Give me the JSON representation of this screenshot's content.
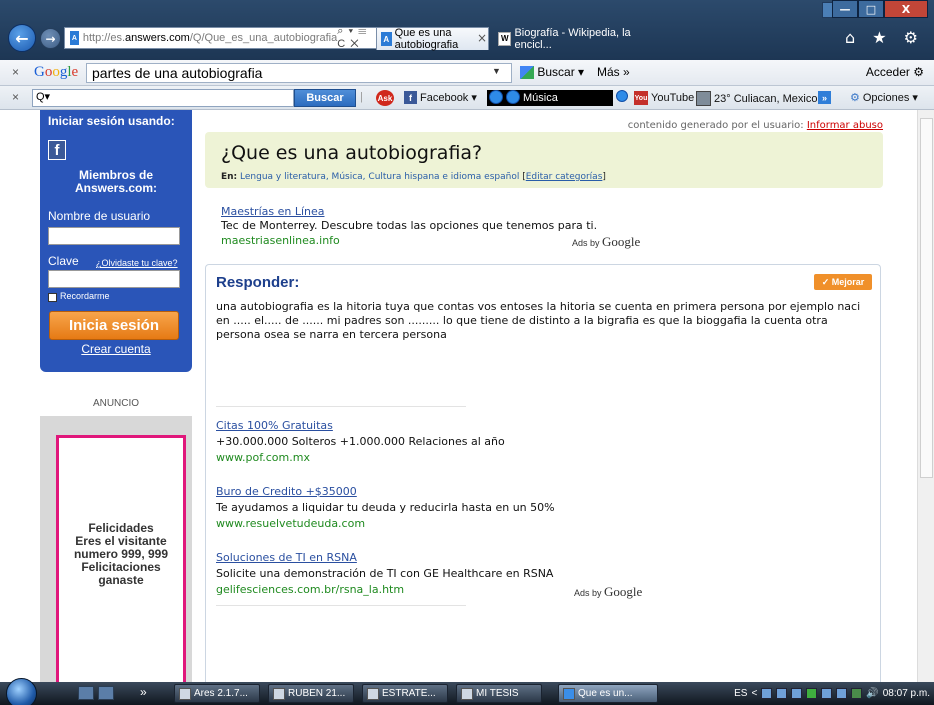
{
  "browser": {
    "url_prefix": "http://es.",
    "url_host": "answers.com",
    "url_path": "/Q/Que_es_una_autobiografia",
    "address_tools": "⌕ ▾ ☰ C ✕",
    "tab_active_label": "Que es una autobiografia",
    "tab_inactive_label": "Biografía - Wikipedia, la encicl...",
    "tab_close": "×",
    "update_label": "b",
    "window_min": "—",
    "window_max": "□",
    "window_close": "X",
    "right_icons": "⌂ ★ ⚙"
  },
  "google_toolbar": {
    "close": "×",
    "logo": "Google",
    "query": "partes de una autobiografia",
    "search_label": "Buscar ▾",
    "more_label": "Más »",
    "signin_label": "Acceder"
  },
  "ask_toolbar": {
    "close": "×",
    "search_placeholder": "Q▾",
    "search_button": "Buscar",
    "facebook": "Facebook ▾",
    "music": "Música",
    "youtube": "YouTube",
    "weather": "23° Culiacan, Mexico ▾",
    "more": "»",
    "options": "Opciones ▾"
  },
  "sidebar": {
    "login_title": "Iniciar sesión usando:",
    "fb_letter": "f",
    "members_title_1": "Miembros de",
    "members_title_2": "Answers.com:",
    "username_label": "Nombre de usuario",
    "password_label": "Clave",
    "forgot_label": "¿Olvidaste tu clave?",
    "remember_label": "Recordarme",
    "login_button": "Inicia sesión",
    "create_account": "Crear cuenta",
    "ad_label": "ANUNCIO",
    "ad_text_1": "Felicidades",
    "ad_text_2": "Eres el visitante",
    "ad_text_3": "numero 999, 999",
    "ad_text_4": "Felicitaciones",
    "ad_text_5": "ganaste"
  },
  "main": {
    "report_prefix": "contenido generado por el usuario:",
    "report_link": "Informar abuso",
    "question_title": "¿Que es una autobiografia?",
    "categories_prefix": "En:",
    "categories": "Lengua y literatura, Música, Cultura hispana e idioma español",
    "edit_categories": "Editar categorías",
    "top_ad": {
      "title": "Maestrías en Línea",
      "desc": "Tec de Monterrey. Descubre todas las opciones que tenemos para ti.",
      "url": "maestriasenlinea.info"
    },
    "ads_by_prefix": "Ads by",
    "ads_by_brand": "Google",
    "answer_heading": "Responder:",
    "improve_button": "✓ Mejorar",
    "answer_text": "una autobiografia es la hitoria tuya que contas vos entoses la hitoria se cuenta en primera persona por ejemplo naci en ..... el..... de ...... mi padres son ......... lo que tiene de distinto a la bigrafia es que la bioggafia la cuenta otra persona osea se narra en tercera persona",
    "ads": [
      {
        "title": "Citas 100% Gratuitas",
        "desc": "+30.000.000 Solteros +1.000.000 Relaciones al año",
        "url": "www.pof.com.mx"
      },
      {
        "title": "Buro de Credito +$35000",
        "desc": "Te ayudamos a liquidar tu deuda y reducirla hasta en un 50%",
        "url": "www.resuelvetudeuda.com"
      },
      {
        "title": "Soluciones de TI en RSNA",
        "desc": "Solicite una demonstración de TI con GE Healthcare en RSNA",
        "url": "gelifesciences.com.br/rsna_la.htm"
      }
    ]
  },
  "taskbar": {
    "tasks": [
      "Ares 2.1.7...",
      "RUBEN 21...",
      "ESTRATE...",
      "MI TESIS",
      "Que es un..."
    ],
    "lang": "ES",
    "clock": "08:07 p.m."
  }
}
